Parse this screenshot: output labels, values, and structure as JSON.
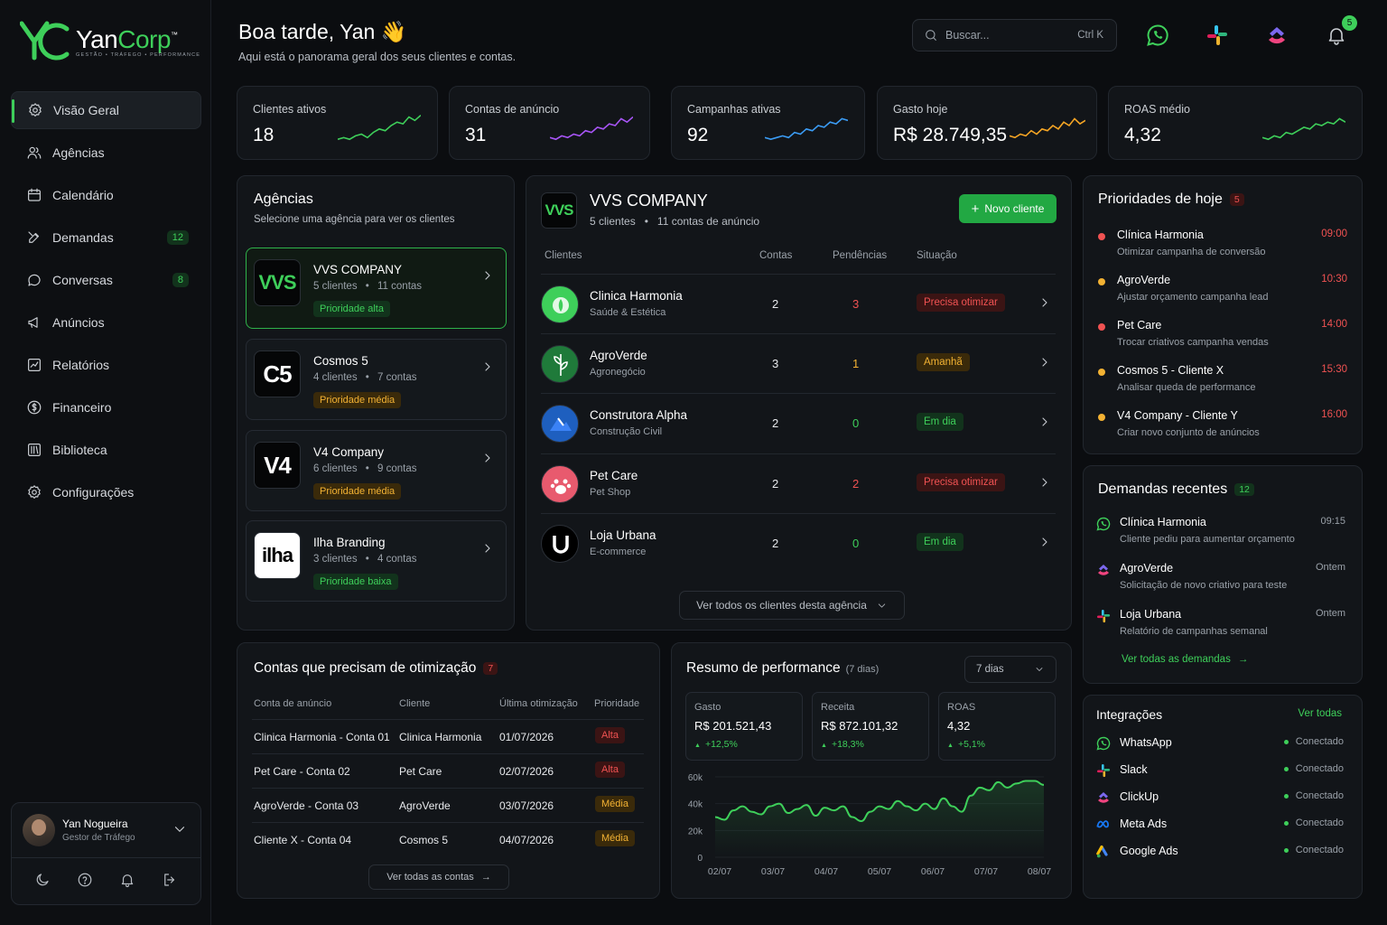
{
  "brand": {
    "name_a": "Yan",
    "name_b": "Corp",
    "tm": "™",
    "tagline": "GESTÃO • TRÁFEGO • PERFORMANCE"
  },
  "nav": [
    {
      "label": "Visão Geral",
      "icon": "gear-icon",
      "active": true
    },
    {
      "label": "Agências",
      "icon": "users-icon"
    },
    {
      "label": "Calendário",
      "icon": "calendar-icon"
    },
    {
      "label": "Demandas",
      "icon": "tools-icon",
      "badge": "12"
    },
    {
      "label": "Conversas",
      "icon": "chat-icon",
      "badge": "8"
    },
    {
      "label": "Anúncios",
      "icon": "megaphone-icon"
    },
    {
      "label": "Relatórios",
      "icon": "chart-icon"
    },
    {
      "label": "Financeiro",
      "icon": "dollar-icon"
    },
    {
      "label": "Biblioteca",
      "icon": "library-icon"
    },
    {
      "label": "Configurações",
      "icon": "settings-icon"
    }
  ],
  "user": {
    "name": "Yan Nogueira",
    "role": "Gestor de Tráfego"
  },
  "header": {
    "greeting": "Boa tarde, Yan 👋",
    "subtitle": "Aqui está o panorama geral dos seus clientes e contas.",
    "search_placeholder": "Buscar...",
    "search_shortcut": "Ctrl K",
    "notifications": "5"
  },
  "kpis": [
    {
      "label": "Clientes ativos",
      "value": "18",
      "color": "#3ecf5a"
    },
    {
      "label": "Contas de anúncio",
      "value": "31",
      "color": "#a855f7"
    },
    {
      "label": "Campanhas ativas",
      "value": "92",
      "color": "#3b9cf5"
    },
    {
      "label": "Gasto hoje",
      "value": "R$ 28.749,35",
      "color": "#f5a524"
    },
    {
      "label": "ROAS médio",
      "value": "4,32",
      "color": "#3ecf5a"
    }
  ],
  "agencies": {
    "title": "Agências",
    "subtitle": "Selecione uma agência para ver os clientes",
    "items": [
      {
        "logo": "VVS",
        "name": "VVS COMPANY",
        "clients": "5 clientes",
        "accounts": "11 contas",
        "priority": "Prioridade alta",
        "level": "alta"
      },
      {
        "logo": "C5",
        "name": "Cosmos 5",
        "clients": "4 clientes",
        "accounts": "7 contas",
        "priority": "Prioridade média",
        "level": "media"
      },
      {
        "logo": "V4",
        "name": "V4 Company",
        "clients": "6 clientes",
        "accounts": "9 contas",
        "priority": "Prioridade média",
        "level": "media"
      },
      {
        "logo": "ilha",
        "name": "Ilha Branding",
        "clients": "3 clientes",
        "accounts": "4 contas",
        "priority": "Prioridade baixa",
        "level": "baixa"
      }
    ]
  },
  "clients_panel": {
    "logo": "VVS",
    "title": "VVS COMPANY",
    "clients": "5 clientes",
    "accounts": "11 contas de anúncio",
    "new_button": "Novo cliente",
    "columns": [
      "Clientes",
      "Contas",
      "Pendências",
      "Situação"
    ],
    "rows": [
      {
        "name": "Clinica Harmonia",
        "segment": "Saúde & Estética",
        "accounts": "2",
        "pending": "3",
        "status": "Precisa otimizar",
        "kind": "red",
        "avatar_color": "#3ecf5a"
      },
      {
        "name": "AgroVerde",
        "segment": "Agronegócio",
        "accounts": "3",
        "pending": "1",
        "status": "Amanhã",
        "kind": "yel",
        "avatar_color": "#1f7a3a"
      },
      {
        "name": "Construtora Alpha",
        "segment": "Construção Civil",
        "accounts": "2",
        "pending": "0",
        "status": "Em dia",
        "kind": "grn",
        "avatar_color": "#1e5fbf"
      },
      {
        "name": "Pet Care",
        "segment": "Pet Shop",
        "accounts": "2",
        "pending": "2",
        "status": "Precisa otimizar",
        "kind": "red",
        "avatar_color": "#e85a6e"
      },
      {
        "name": "Loja Urbana",
        "segment": "E-commerce",
        "accounts": "2",
        "pending": "0",
        "status": "Em dia",
        "kind": "grn",
        "avatar_color": "#000000"
      }
    ],
    "view_all": "Ver todos os clientes desta agência"
  },
  "priorities": {
    "title": "Prioridades de hoje",
    "count": "5",
    "items": [
      {
        "name": "Clínica Harmonia",
        "desc": "Otimizar campanha de conversão",
        "time": "09:00",
        "color": "#f05252"
      },
      {
        "name": "AgroVerde",
        "desc": "Ajustar orçamento campanha lead",
        "time": "10:30",
        "color": "#f3b233"
      },
      {
        "name": "Pet Care",
        "desc": "Trocar criativos campanha vendas",
        "time": "14:00",
        "color": "#f05252"
      },
      {
        "name": "Cosmos 5 - Cliente X",
        "desc": "Analisar queda de performance",
        "time": "15:30",
        "color": "#f3b233"
      },
      {
        "name": "V4 Company - Cliente Y",
        "desc": "Criar novo conjunto de anúncios",
        "time": "16:00",
        "color": "#f3b233"
      }
    ]
  },
  "demands": {
    "title": "Demandas recentes",
    "count": "12",
    "items": [
      {
        "name": "Clínica Harmonia",
        "desc": "Cliente pediu para aumentar orçamento",
        "time": "09:15",
        "icon": "whatsapp-icon"
      },
      {
        "name": "AgroVerde",
        "desc": "Solicitação de novo criativo para teste",
        "time": "Ontem",
        "icon": "clickup-icon"
      },
      {
        "name": "Loja Urbana",
        "desc": "Relatório de campanhas semanal",
        "time": "Ontem",
        "icon": "slack-icon"
      }
    ],
    "view_all": "Ver todas as demandas"
  },
  "integrations": {
    "title": "Integrações",
    "view_all": "Ver todas",
    "items": [
      {
        "name": "WhatsApp",
        "status": "Conectado",
        "icon": "whatsapp-icon"
      },
      {
        "name": "Slack",
        "status": "Conectado",
        "icon": "slack-icon"
      },
      {
        "name": "ClickUp",
        "status": "Conectado",
        "icon": "clickup-icon"
      },
      {
        "name": "Meta Ads",
        "status": "Conectado",
        "icon": "meta-icon"
      },
      {
        "name": "Google Ads",
        "status": "Conectado",
        "icon": "google-ads-icon"
      }
    ]
  },
  "optimization": {
    "title": "Contas que precisam de otimização",
    "count": "7",
    "columns": [
      "Conta de anúncio",
      "Cliente",
      "Última otimização",
      "Prioridade"
    ],
    "rows": [
      {
        "account": "Clinica Harmonia - Conta 01",
        "client": "Clinica Harmonia",
        "date": "01/07/2026",
        "priority": "Alta",
        "kind": "red"
      },
      {
        "account": "Pet Care - Conta 02",
        "client": "Pet Care",
        "date": "02/07/2026",
        "priority": "Alta",
        "kind": "red"
      },
      {
        "account": "AgroVerde - Conta 03",
        "client": "AgroVerde",
        "date": "03/07/2026",
        "priority": "Média",
        "kind": "yel"
      },
      {
        "account": "Cliente X - Conta 04",
        "client": "Cosmos 5",
        "date": "04/07/2026",
        "priority": "Média",
        "kind": "yel"
      }
    ],
    "view_all": "Ver todas as contas"
  },
  "performance": {
    "title": "Resumo de performance",
    "period_note": "(7 dias)",
    "select": "7 dias",
    "metrics": [
      {
        "label": "Gasto",
        "value": "R$ 201.521,43",
        "delta": "+12,5%"
      },
      {
        "label": "Receita",
        "value": "R$ 872.101,32",
        "delta": "+18,3%"
      },
      {
        "label": "ROAS",
        "value": "4,32",
        "delta": "+5,1%"
      }
    ]
  },
  "chart_data": {
    "type": "line",
    "x": [
      "02/07",
      "03/07",
      "04/07",
      "05/07",
      "06/07",
      "07/07",
      "08/07"
    ],
    "y_ticks": [
      "0",
      "20k",
      "40k",
      "60k"
    ],
    "ylim": [
      0,
      60000
    ],
    "color": "#3ecf5a",
    "series": [
      {
        "values": [
          30000,
          28000,
          35000,
          38000,
          34000,
          32000,
          38000,
          40000,
          33000,
          36000,
          39000,
          31000,
          37000,
          35000,
          38000,
          30000,
          27000,
          34000,
          38000,
          36000,
          42000,
          38000,
          35000,
          40000,
          36000,
          44000,
          38000,
          34000,
          46000,
          52000,
          50000,
          56000,
          52000,
          55000,
          57000,
          57000,
          54000
        ]
      }
    ]
  }
}
